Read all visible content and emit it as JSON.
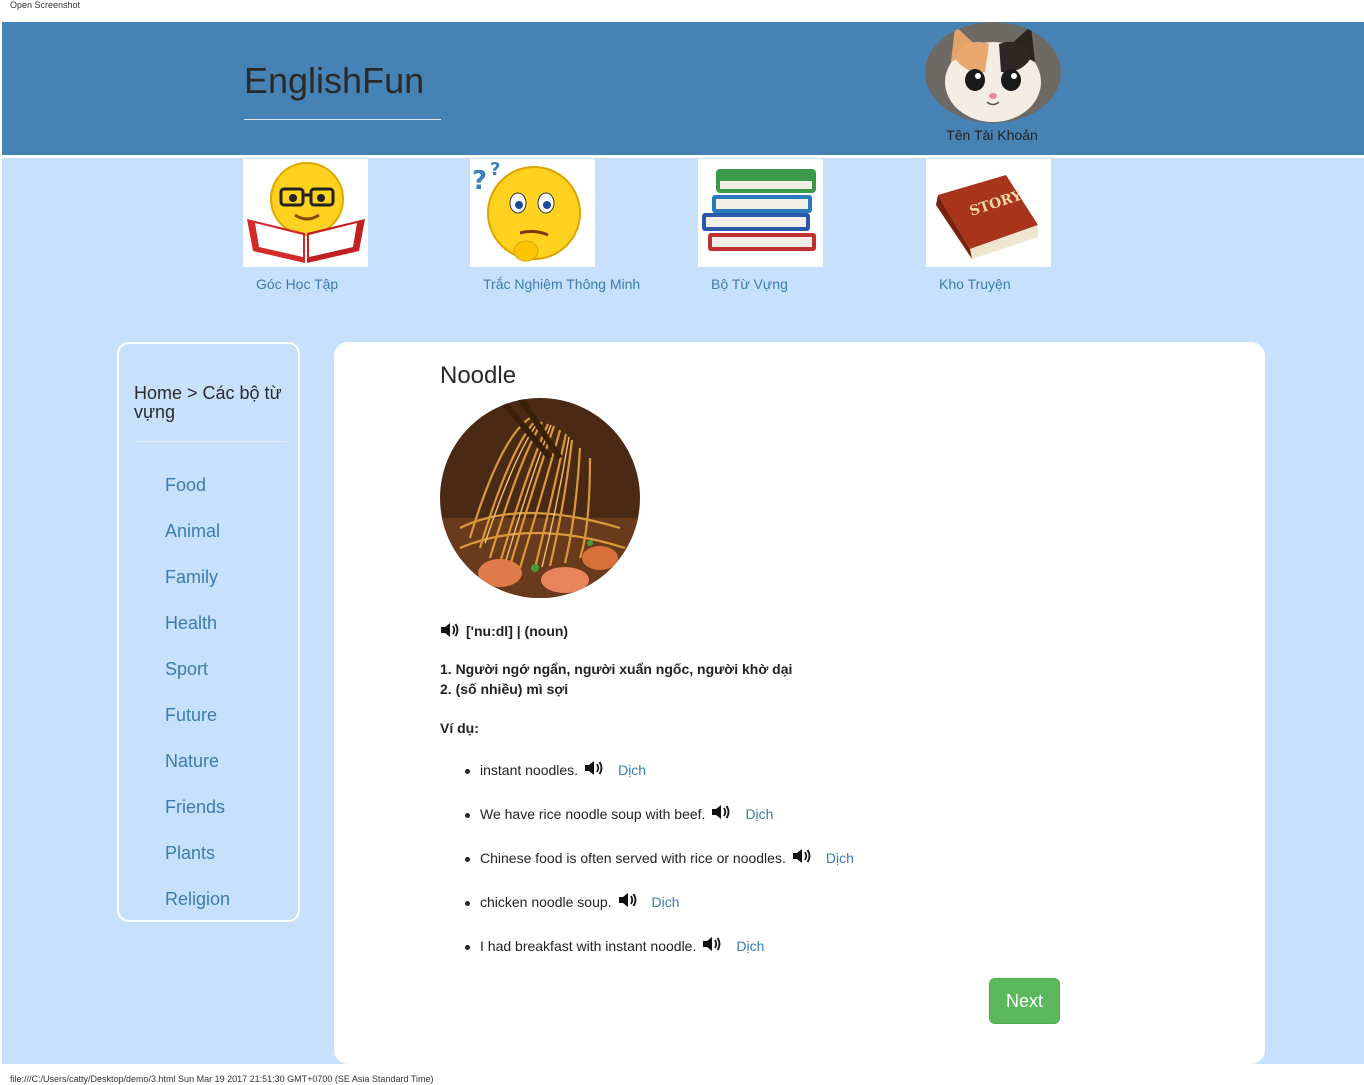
{
  "print": {
    "header": "Open Screenshot",
    "footer": "file:///C:/Users/catty/Desktop/demo/3.html Sun Mar 19 2017 21:51:30 GMT+0700 (SE Asia Standard Time)"
  },
  "header": {
    "brand": "EnglishFun",
    "account_name": "Tên Tài Khoản",
    "background": "#4682b4"
  },
  "features": [
    {
      "label": "Góc Học Tập",
      "icon": "reading-emoji-icon"
    },
    {
      "label": "Trắc Nghiệm Thông Minh",
      "icon": "thinking-emoji-icon"
    },
    {
      "label": "Bộ Từ Vựng",
      "icon": "book-stack-icon"
    },
    {
      "label": "Kho Truyện",
      "icon": "story-book-icon"
    }
  ],
  "sidebar": {
    "breadcrumb": "Home > Các bộ từ vựng",
    "categories": [
      "Food",
      "Animal",
      "Family",
      "Health",
      "Sport",
      "Future",
      "Nature",
      "Friends",
      "Plants",
      "Religion"
    ]
  },
  "word": {
    "title": "Noodle",
    "pronunciation": "['nu:dl] | (noun)",
    "definitions": [
      "1. Người ngớ ngẩn, người xuẩn ngốc, người khờ dại",
      "2. (số nhiều) mì sợi"
    ],
    "examples_label": "Ví dụ:",
    "examples": [
      {
        "text": "instant noodles.",
        "translate": "Dịch"
      },
      {
        "text": "We have rice noodle soup with beef.",
        "translate": "Dịch"
      },
      {
        "text": "Chinese food is often served with rice or noodles.",
        "translate": "Dịch"
      },
      {
        "text": "chicken noodle soup.",
        "translate": "Dịch"
      },
      {
        "text": "I had breakfast with instant noodle.",
        "translate": "Dịch"
      }
    ]
  },
  "actions": {
    "next_label": "Next"
  },
  "colors": {
    "accent": "#4682b4",
    "page_bg": "#c7e1fc",
    "link": "#3b7bb0",
    "next_button": "#5cb85c"
  }
}
